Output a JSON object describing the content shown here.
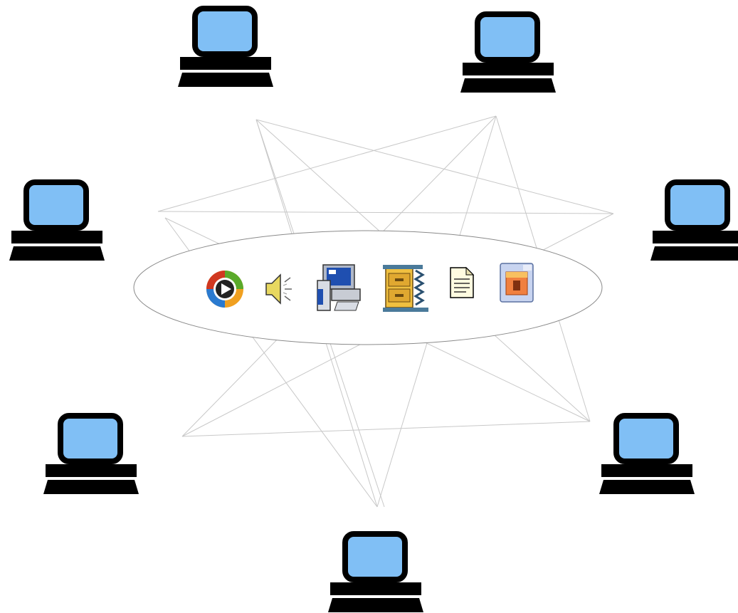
{
  "diagram": {
    "nodes": [
      {
        "id": "computer-top-left",
        "icon": "computer-icon"
      },
      {
        "id": "computer-top-right",
        "icon": "computer-icon"
      },
      {
        "id": "computer-left",
        "icon": "computer-icon"
      },
      {
        "id": "computer-right",
        "icon": "computer-icon"
      },
      {
        "id": "computer-bottom-left",
        "icon": "computer-icon"
      },
      {
        "id": "computer-bottom-right",
        "icon": "computer-icon"
      },
      {
        "id": "computer-bottom",
        "icon": "computer-icon"
      }
    ],
    "hub_icons": [
      "media-player-icon",
      "speaker-icon",
      "network-computer-icon",
      "file-cabinet-archive-icon",
      "text-document-icon",
      "picture-file-icon"
    ],
    "colors": {
      "screen": "#80bff5",
      "device": "#000000",
      "mesh": "#c8c8c8",
      "hub_outline": "#8a8a8a"
    }
  }
}
